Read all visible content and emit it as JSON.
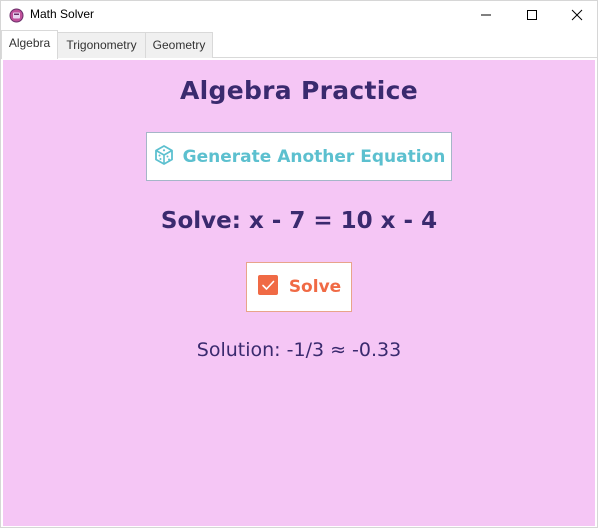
{
  "window": {
    "title": "Math Solver",
    "icon": "app-icon"
  },
  "title_bar": {
    "minimize_icon": "minimize-icon",
    "maximize_icon": "maximize-icon",
    "close_icon": "close-icon"
  },
  "tabs": [
    {
      "label": "Algebra",
      "active": true
    },
    {
      "label": "Trigonometry",
      "active": false
    },
    {
      "label": "Geometry",
      "active": false
    }
  ],
  "main": {
    "heading": "Algebra Practice",
    "generate_button": {
      "label": "Generate Another Equation",
      "icon": "dice-icon"
    },
    "equation": "Solve: x - 7 = 10 x - 4",
    "solve_button": {
      "label": "Solve",
      "icon": "checkbox-icon"
    },
    "solution": "Solution: -1/3 ≈ -0.33"
  },
  "colors": {
    "background": "#f5c6f5",
    "heading": "#3a2a6e",
    "generate_accent": "#5cc0cf",
    "solve_accent": "#f06a45"
  }
}
